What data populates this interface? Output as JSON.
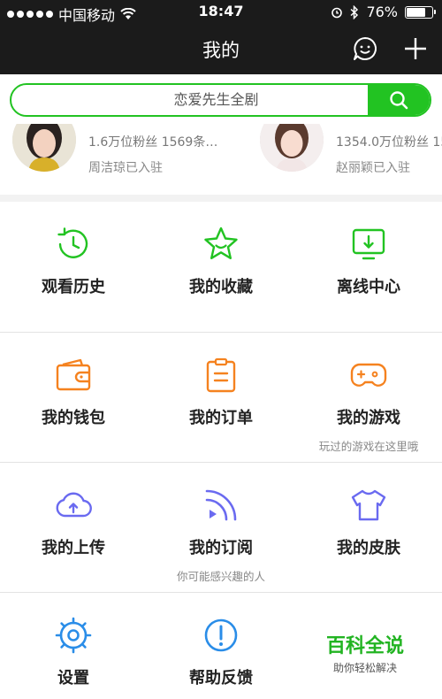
{
  "status_bar": {
    "carrier": "中国移动",
    "time": "18:47",
    "battery": "76%",
    "battery_level": 0.76
  },
  "navbar": {
    "title": "我的"
  },
  "search": {
    "placeholder": "恋爱先生全剧"
  },
  "stars": [
    {
      "fans": "1.6万位粉丝 1569条…",
      "who": "周洁琼已入驻"
    },
    {
      "fans": "1354.0万位粉丝 15",
      "who": "赵丽颖已入驻"
    }
  ],
  "grid": {
    "row1": [
      {
        "label": "观看历史",
        "icon": "history-icon"
      },
      {
        "label": "我的收藏",
        "icon": "star-icon"
      },
      {
        "label": "离线中心",
        "icon": "download-icon"
      }
    ],
    "row2": [
      {
        "label": "我的钱包",
        "icon": "wallet-icon"
      },
      {
        "label": "我的订单",
        "icon": "order-icon"
      },
      {
        "label": "我的游戏",
        "icon": "gamepad-icon",
        "sub": "玩过的游戏在这里哦"
      }
    ],
    "row3": [
      {
        "label": "我的上传",
        "icon": "upload-cloud-icon"
      },
      {
        "label": "我的订阅",
        "icon": "rss-icon",
        "sub": "你可能感兴趣的人"
      },
      {
        "label": "我的皮肤",
        "icon": "shirt-icon"
      }
    ],
    "row4": [
      {
        "label": "设置",
        "icon": "settings-icon"
      },
      {
        "label": "帮助反馈",
        "icon": "help-icon"
      }
    ]
  },
  "watermark": {
    "title": "百科全说",
    "subtitle": "助你轻松解决"
  },
  "colors": {
    "accent": "#22c322",
    "orange": "#f5821f",
    "purple": "#6a6af0",
    "blue": "#2a8de8",
    "dark": "#1b1b1b"
  }
}
